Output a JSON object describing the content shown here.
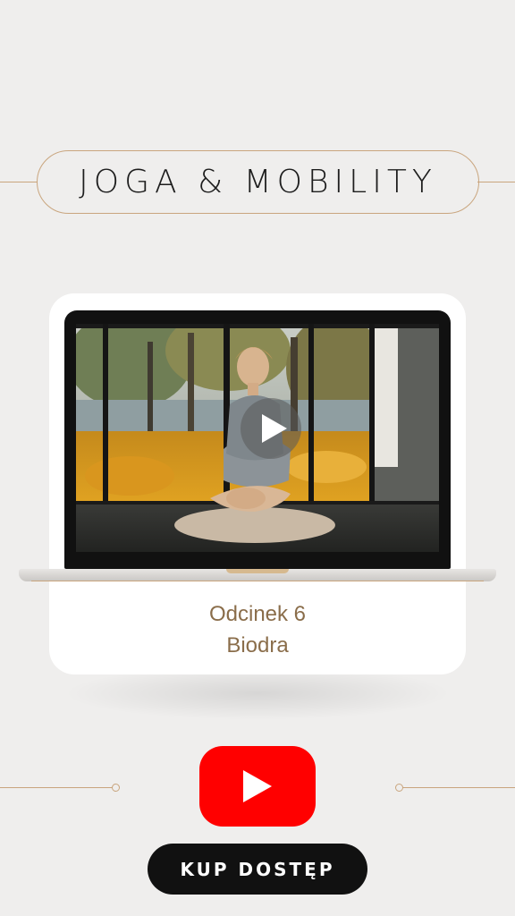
{
  "header": {
    "title": "JOGA & MOBILITY"
  },
  "video": {
    "thumbnail": "yoga-hip-stretch-photo",
    "play_icon": "play-icon"
  },
  "episode": {
    "label": "Odcinek 6",
    "topic": "Biodra"
  },
  "youtube": {
    "icon": "youtube-play-icon",
    "color": "#ff0000"
  },
  "cta": {
    "label": "KUP DOSTĘP"
  },
  "colors": {
    "background": "#efeeed",
    "accent": "#c9a57e",
    "caption": "#8a6d4a",
    "button": "#111111"
  }
}
